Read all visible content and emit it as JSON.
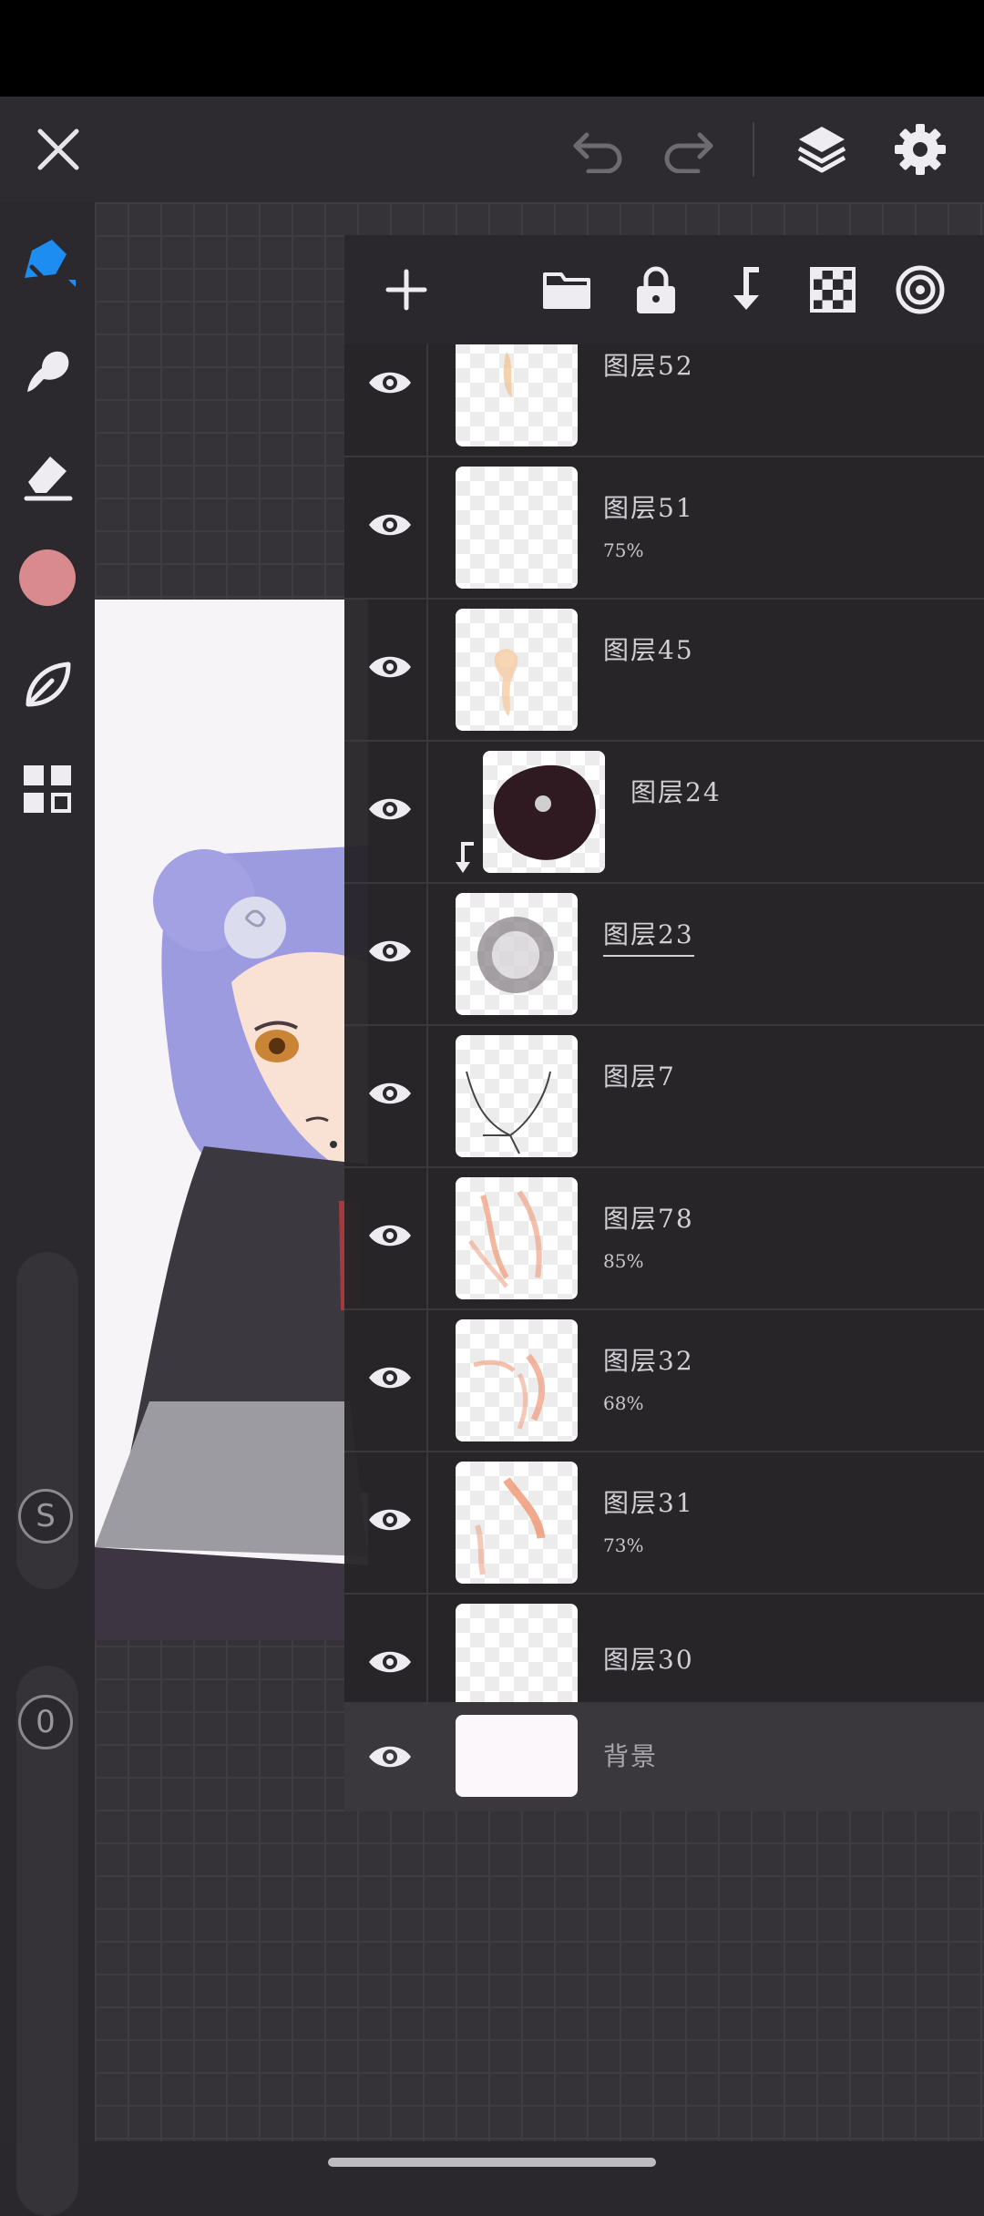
{
  "colors": {
    "accent": "#1e8df2",
    "current_color": "#d98a8f"
  },
  "topbar": {
    "icons": [
      "close-icon",
      "undo-icon",
      "redo-icon",
      "layers-icon",
      "settings-icon"
    ]
  },
  "left_toolbar": {
    "tools": [
      "pen-tool-icon",
      "smudge-tool-icon",
      "eraser-tool-icon",
      "color-swatch",
      "leaf-brush-icon",
      "grid-menu-icon"
    ],
    "size_slider_label": "S",
    "opacity_slider_label": "0"
  },
  "layers_panel": {
    "toolbar_icons": [
      "add-layer-icon",
      "folder-icon",
      "lock-icon",
      "merge-down-icon",
      "transparency-icon",
      "blend-icon"
    ],
    "layers": [
      {
        "name": "图层52",
        "opacity": ""
      },
      {
        "name": "图层51",
        "opacity": "75%"
      },
      {
        "name": "图层45",
        "opacity": ""
      },
      {
        "name": "图层24",
        "opacity": ""
      },
      {
        "name": "图层23",
        "opacity": ""
      },
      {
        "name": "图层7",
        "opacity": ""
      },
      {
        "name": "图层78",
        "opacity": "85%"
      },
      {
        "name": "图层32",
        "opacity": "68%"
      },
      {
        "name": "图层31",
        "opacity": "73%"
      },
      {
        "name": "图层30",
        "opacity": ""
      }
    ],
    "background_layer": {
      "name": "背景"
    }
  }
}
